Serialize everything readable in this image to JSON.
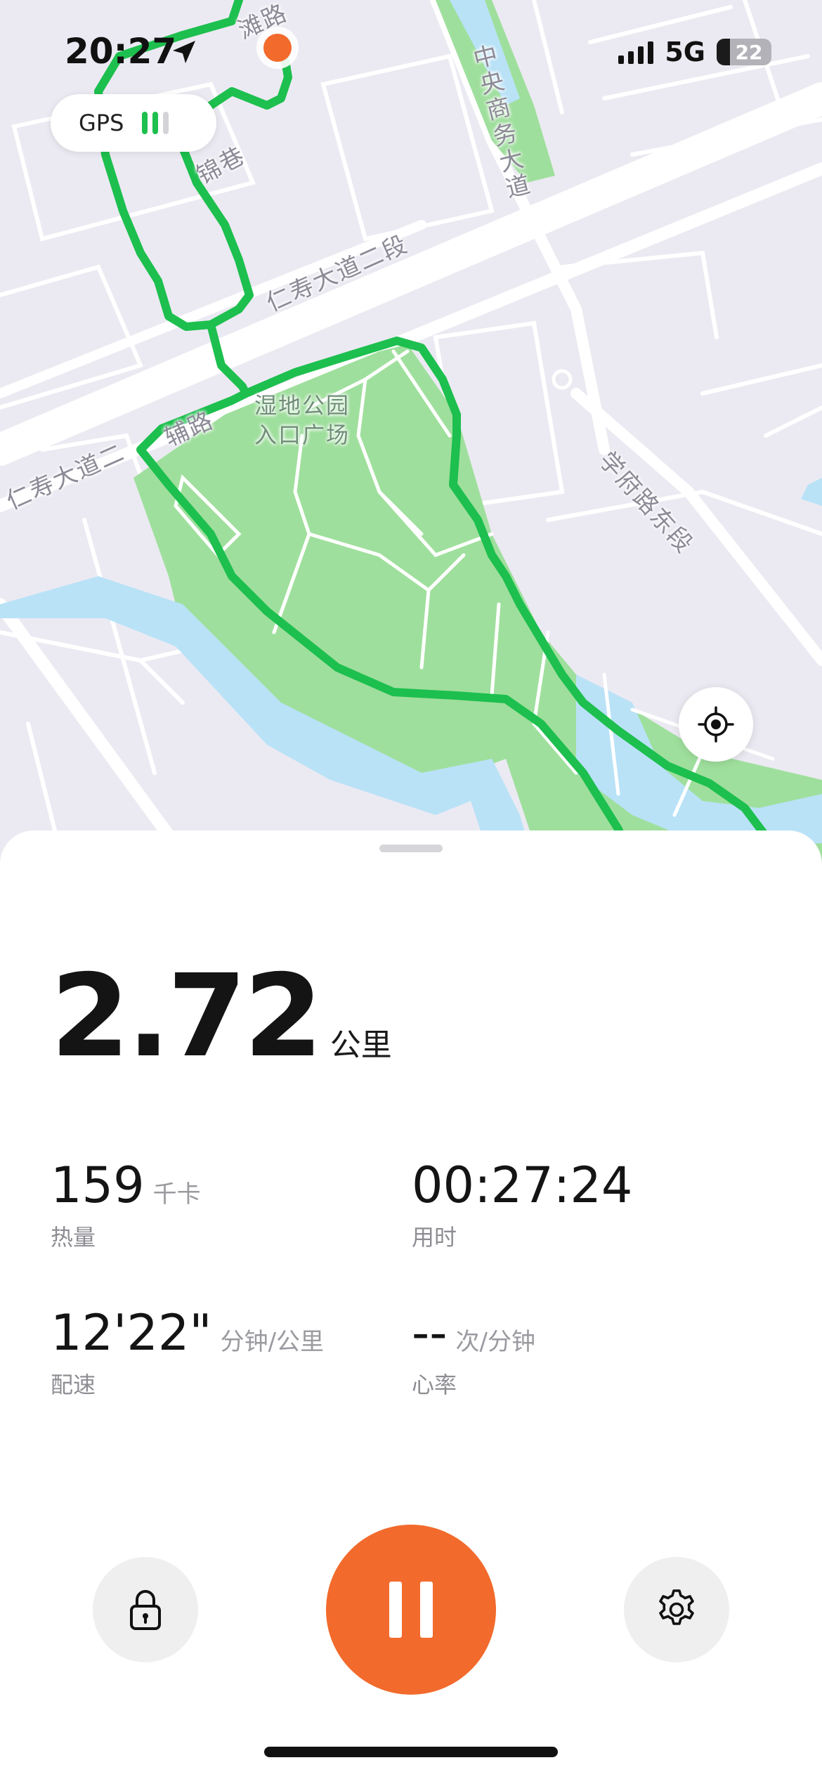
{
  "status_bar": {
    "time": "20:27",
    "network": "5G",
    "battery": "22"
  },
  "map": {
    "gps_label": "GPS",
    "gps_signal_bars": 2,
    "gps_signal_total": 3,
    "road_labels": {
      "ren_shou_top": "仁寿大道二段",
      "ren_shou_left": "仁寿大道二",
      "fu_jin": "辅路",
      "zhong_yang": "中央商务大道",
      "xue_fu": "学府路东段",
      "alley": "锦巷",
      "top_road": "滩路"
    },
    "park_label_line1": "湿地公园",
    "park_label_line2": "入口广场",
    "colors": {
      "route": "#1dbf4e",
      "park": "#9fdf9d",
      "water": "#b9e2f7",
      "background": "#ebeaf2",
      "current_position": "#f26a2c"
    }
  },
  "workout": {
    "distance": "2.72",
    "distance_unit": "公里",
    "calories": {
      "value": "159",
      "unit": "千卡",
      "label": "热量"
    },
    "duration": {
      "value": "00:27:24",
      "label": "用时"
    },
    "pace": {
      "value": "12'22\"",
      "unit": "分钟/公里",
      "label": "配速"
    },
    "heart_rate": {
      "value": "--",
      "unit": "次/分钟",
      "label": "心率"
    }
  },
  "controls": {
    "lock": "lock-icon",
    "pause": "pause-icon",
    "settings": "gear-icon",
    "pause_color": "#f26a2c"
  }
}
